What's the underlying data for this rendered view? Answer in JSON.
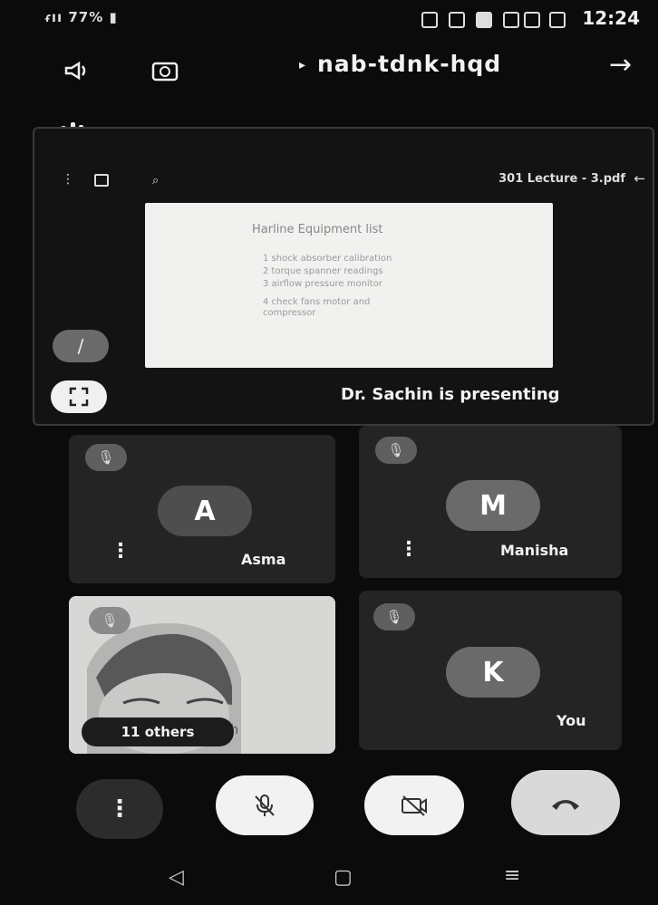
{
  "status_bar": {
    "left_text": "ᵳıı 77% ▮",
    "clock": "12:24"
  },
  "header": {
    "title": "nab-tdnk-hqd",
    "back_icon": "→",
    "dropdown_icon": "▸"
  },
  "presentation": {
    "pdf_name": "301 Lecture - 3.pdf",
    "slide_title": "Harline Equipment list",
    "slide_lines": [
      "1  shock absorber calibration",
      "2  torque spanner readings",
      "3  airflow pressure monitor",
      "4  check fans motor and",
      "   compressor"
    ],
    "presenting_text": "Dr. Sachin is presenting"
  },
  "participants": [
    {
      "name": "Asma",
      "initial": "A"
    },
    {
      "name": "Manisha",
      "initial": "M"
    },
    {
      "name": "You",
      "initial": "K"
    }
  ],
  "video_tile": {
    "others_label": "11 others",
    "name_partial": "Jaysh"
  },
  "controls": {
    "more": "⋮",
    "mic": "✕",
    "camera": "▭",
    "end_call": "☎"
  },
  "nav": {
    "back": "◁",
    "home": "▢",
    "recents": "≡"
  }
}
